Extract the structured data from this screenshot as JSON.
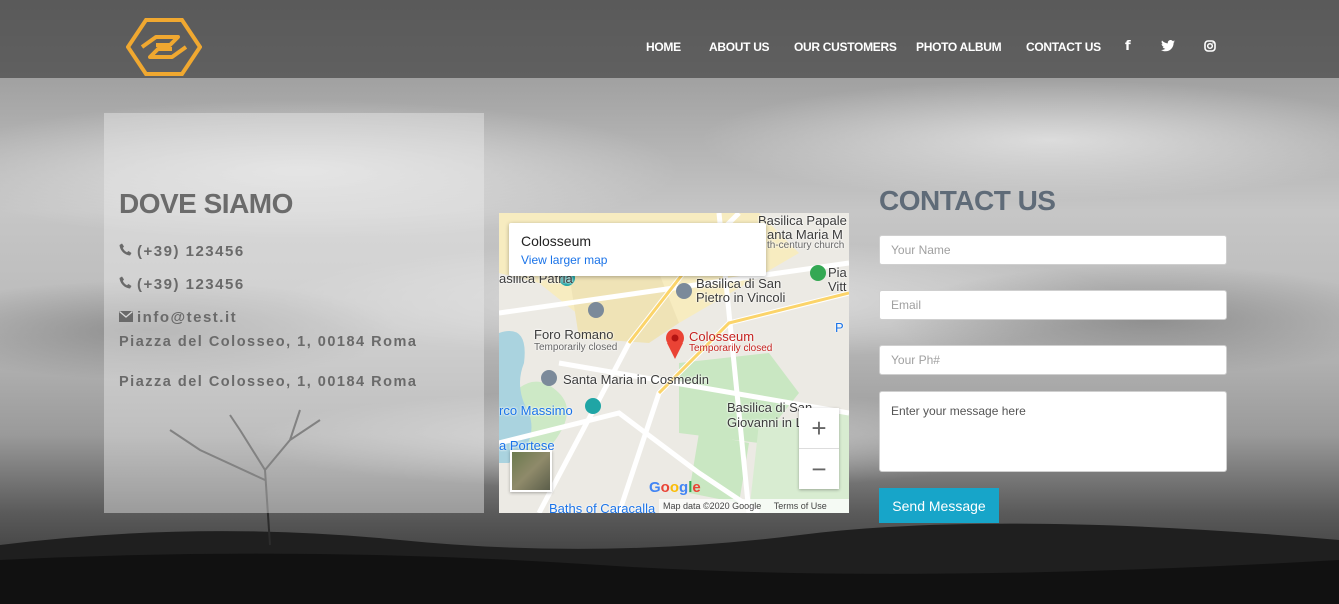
{
  "nav": {
    "items": [
      "HOME",
      "ABOUT US",
      "OUR CUSTOMERS",
      "PHOTO ALBUM",
      "CONTACT US"
    ],
    "social": [
      "facebook-icon",
      "twitter-icon",
      "instagram-icon"
    ]
  },
  "brand": {
    "accent": "#f0a830"
  },
  "location": {
    "title": "DOVE SIAMO",
    "phone1": "(+39) 123456",
    "phone2": "(+39) 123456",
    "email": "info@test.it",
    "address1": "Piazza del Colosseo, 1, 00184 Roma",
    "address2": "Piazza del Colosseo, 1, 00184 Roma"
  },
  "map": {
    "place_title": "Colosseum",
    "larger_map_link": "View larger map",
    "labels": {
      "basilica_papale": "Basilica Papale",
      "santa_maria_m": "anta Maria M",
      "century_church": "th-century church",
      "basilica_patria": "asilica Patria",
      "basilica_san_pietro_1": "Basilica di San",
      "basilica_san_pietro_2": "Pietro in Vincoli",
      "piazza": "Pia",
      "vitt": "Vitt",
      "p_label": "P",
      "foro_romano": "Foro Romano",
      "foro_closed": "Temporarily closed",
      "colosseum": "Colosseum",
      "colosseum_closed": "Temporarily closed",
      "santa_maria_cosmedin": "Santa Maria in Cosmedin",
      "circo_massimo": "rco Massimo",
      "basilica_giovanni_1": "Basilica di San",
      "basilica_giovanni_2": "Giovanni in Latera",
      "porta_portese": "a Portese",
      "baths": "Baths of Caracalla"
    },
    "zoom_in": "+",
    "zoom_out": "−",
    "google": "Google",
    "map_data": "Map data ©2020 Google",
    "terms": "Terms of Use"
  },
  "contact": {
    "title": "CONTACT US",
    "name_placeholder": "Your Name",
    "email_placeholder": "Email",
    "phone_placeholder": "Your Ph#",
    "message_placeholder": "Enter your message here",
    "send_label": "Send Message",
    "button_color": "#17a5c9"
  }
}
